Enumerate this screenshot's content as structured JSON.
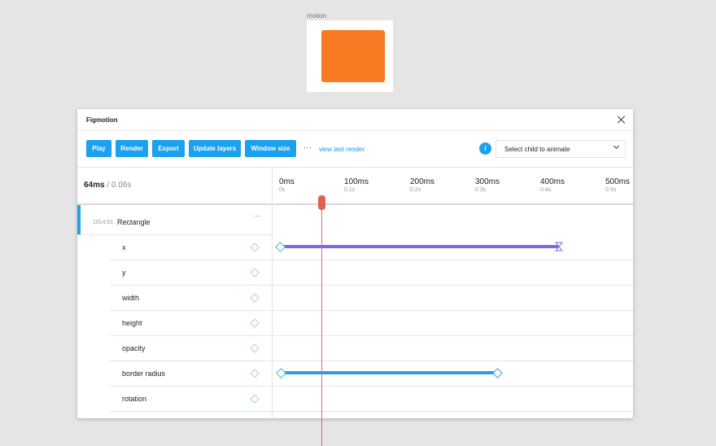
{
  "canvas": {
    "frame_label": "motion",
    "rect_color": "#f97a22"
  },
  "panel": {
    "title": "Figmotion"
  },
  "toolbar": {
    "buttons": [
      "Play",
      "Render",
      "Export",
      "Update layers",
      "Window size"
    ],
    "more": "···",
    "link": "view last render",
    "info": "i",
    "select_value": "Select child to animate"
  },
  "timeline": {
    "current": "64ms",
    "separator": " / ",
    "total": "0.06s",
    "ticks": [
      {
        "ms": "0ms",
        "s": "0s"
      },
      {
        "ms": "100ms",
        "s": "0.1s"
      },
      {
        "ms": "200ms",
        "s": "0.2s"
      },
      {
        "ms": "300ms",
        "s": "0.3s"
      },
      {
        "ms": "400ms",
        "s": "0.4s"
      },
      {
        "ms": "500ms",
        "s": "0.5s"
      }
    ]
  },
  "layer": {
    "id": "1014:61",
    "name": "Rectangle",
    "more": "···"
  },
  "properties": [
    "x",
    "y",
    "width",
    "height",
    "opacity",
    "border radius",
    "rotation"
  ],
  "colors": {
    "accent": "#1aa1ef",
    "x_track": "#7b68e0",
    "radius_track": "#2f9be6",
    "playhead": "#e2604f"
  }
}
